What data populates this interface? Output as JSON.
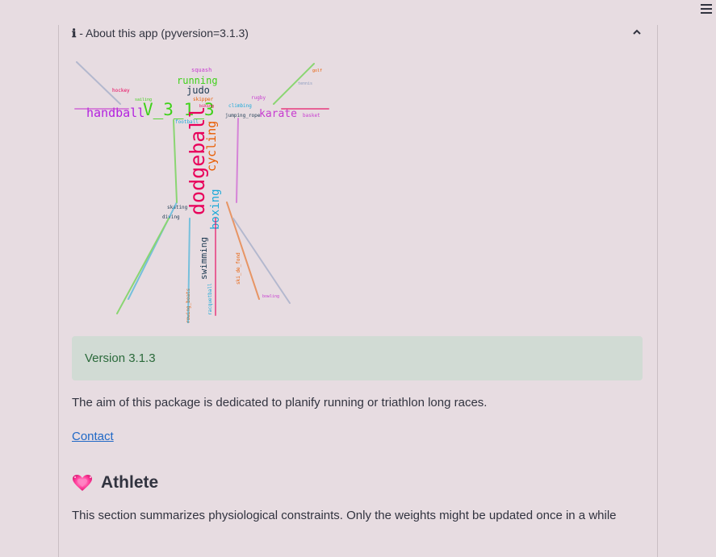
{
  "expander": {
    "icon_glyph": "ℹ",
    "title": " - About this app (pyversion=3.1.3)"
  },
  "wordcloud": {
    "big_words": [
      "dodgeball",
      "V_3_1_3",
      "handball",
      "cycling",
      "boxing",
      "swimming",
      "running",
      "karate",
      "judo"
    ],
    "small_words": [
      "squash",
      "hockey",
      "rugby",
      "skipper",
      "climbing",
      "jumping_rope",
      "football",
      "basket",
      "golf",
      "skating",
      "diving",
      "racquetball",
      "rowing_boats",
      "ski_de_fond",
      "biking",
      "sailing",
      "tennis",
      "bowling"
    ],
    "colors": [
      "#e8005a",
      "#3fd119",
      "#b320e0",
      "#e85c00",
      "#1ba9d8",
      "#1e3a52",
      "#8a9bbf",
      "#c73bd0"
    ]
  },
  "version_box": {
    "text": "Version 3.1.3"
  },
  "aim_text": "The aim of this package is dedicated to planify running or triathlon long races.",
  "contact_link": "Contact",
  "athlete": {
    "icon": "heart-icon",
    "title": "Athlete"
  },
  "section_text": "This section summarizes physiological constraints. Only the weights might be updated once in a while"
}
